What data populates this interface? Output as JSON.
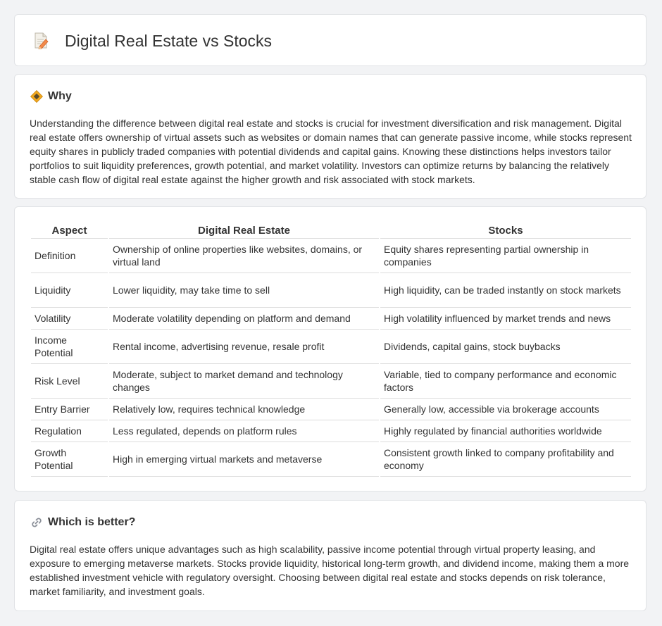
{
  "header": {
    "title": "Digital Real Estate vs Stocks",
    "icon": "document-pencil-icon"
  },
  "why": {
    "title": "Why",
    "icon": "diamond-sign-icon",
    "text": "Understanding the difference between digital real estate and stocks is crucial for investment diversification and risk management. Digital real estate offers ownership of virtual assets such as websites or domain names that can generate passive income, while stocks represent equity shares in publicly traded companies with potential dividends and capital gains. Knowing these distinctions helps investors tailor portfolios to suit liquidity preferences, growth potential, and market volatility. Investors can optimize returns by balancing the relatively stable cash flow of digital real estate against the higher growth and risk associated with stock markets."
  },
  "table": {
    "headers": [
      "Aspect",
      "Digital Real Estate",
      "Stocks"
    ],
    "rows": [
      {
        "aspect": "Definition",
        "digital": "Ownership of online properties like websites, domains, or virtual land",
        "stocks": "Equity shares representing partial ownership in companies"
      },
      {
        "aspect": "Liquidity",
        "digital": "Lower liquidity, may take time to sell",
        "stocks": "High liquidity, can be traded instantly on stock markets"
      },
      {
        "aspect": "Volatility",
        "digital": "Moderate volatility depending on platform and demand",
        "stocks": "High volatility influenced by market trends and news"
      },
      {
        "aspect": "Income Potential",
        "digital": "Rental income, advertising revenue, resale profit",
        "stocks": "Dividends, capital gains, stock buybacks"
      },
      {
        "aspect": "Risk Level",
        "digital": "Moderate, subject to market demand and technology changes",
        "stocks": "Variable, tied to company performance and economic factors"
      },
      {
        "aspect": "Entry Barrier",
        "digital": "Relatively low, requires technical knowledge",
        "stocks": "Generally low, accessible via brokerage accounts"
      },
      {
        "aspect": "Regulation",
        "digital": "Less regulated, depends on platform rules",
        "stocks": "Highly regulated by financial authorities worldwide"
      },
      {
        "aspect": "Growth Potential",
        "digital": "High in emerging virtual markets and metaverse",
        "stocks": "Consistent growth linked to company profitability and economy"
      }
    ]
  },
  "better": {
    "title": "Which is better?",
    "icon": "link-icon",
    "text": "Digital real estate offers unique advantages such as high scalability, passive income potential through virtual property leasing, and exposure to emerging metaverse markets. Stocks provide liquidity, historical long-term growth, and dividend income, making them a more established investment vehicle with regulatory oversight. Choosing between digital real estate and stocks depends on risk tolerance, market familiarity, and investment goals."
  }
}
